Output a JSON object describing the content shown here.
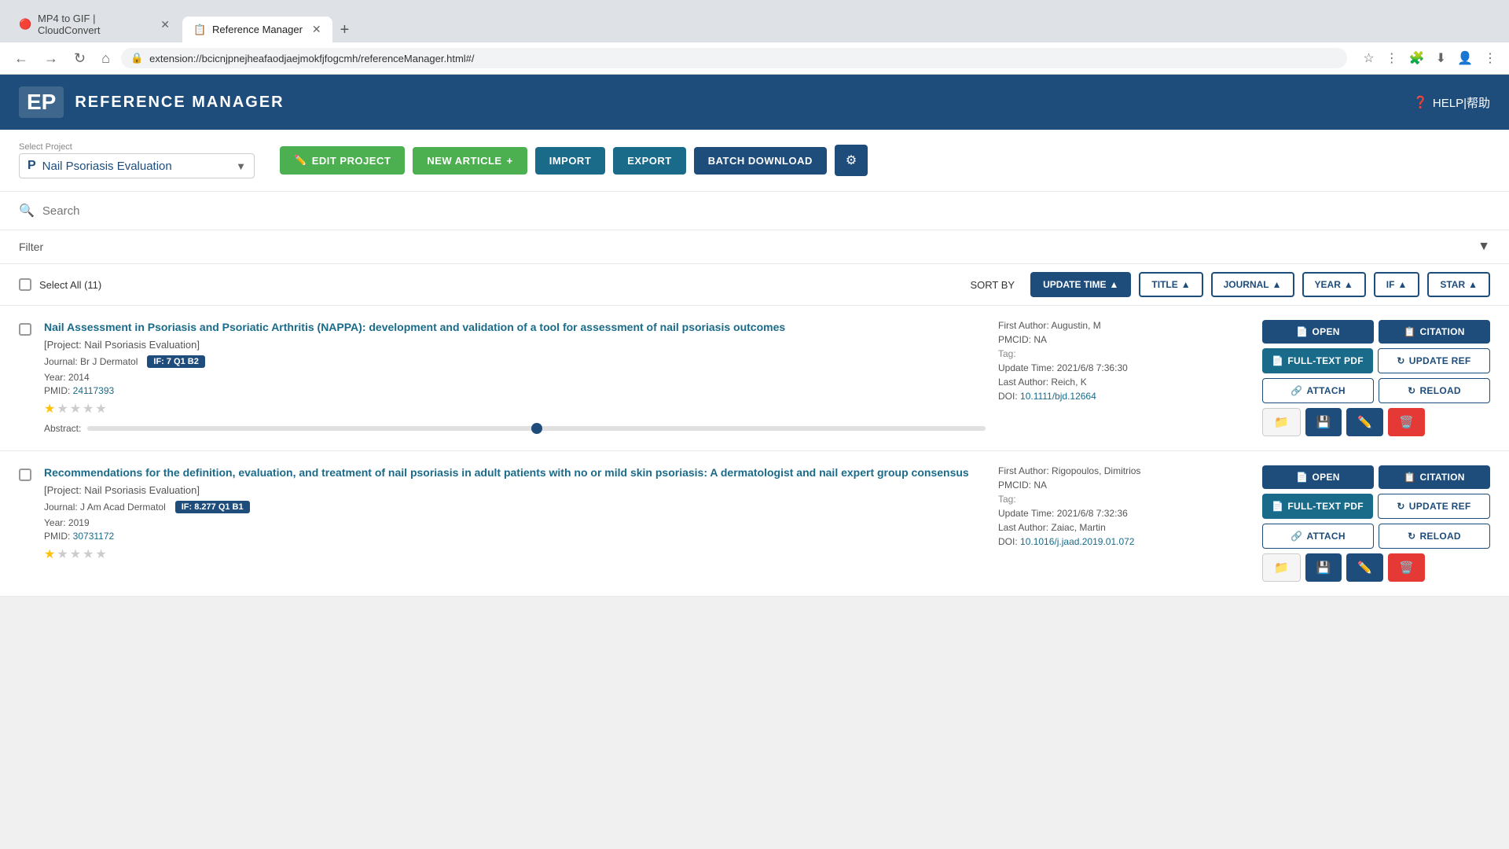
{
  "browser": {
    "tabs": [
      {
        "id": "tab1",
        "label": "MP4 to GIF | CloudConvert",
        "favicon": "🔴",
        "active": false
      },
      {
        "id": "tab2",
        "label": "Reference Manager",
        "favicon": "📋",
        "active": true
      }
    ],
    "url": "extension://bcicnjpnejheafaodjaejmokfjfogcmh/referenceManager.html#/",
    "new_tab": "+"
  },
  "app": {
    "logo_text": "EP",
    "title": "REFERENCE MANAGER",
    "help_label": "HELP|帮助"
  },
  "project": {
    "select_label": "Select Project",
    "icon": "P",
    "name": "Nail Psoriasis Evaluation",
    "buttons": {
      "edit": "EDIT PROJECT",
      "new_article": "NEW ARTICLE",
      "import": "IMPORT",
      "export": "EXPORT",
      "batch_download": "BATCH DOWNLOAD"
    }
  },
  "search": {
    "placeholder": "Search"
  },
  "filter": {
    "label": "Filter"
  },
  "sort": {
    "label": "SORT BY",
    "select_all_label": "Select All (11)",
    "buttons": [
      {
        "id": "update_time",
        "label": "UPDATE TIME",
        "active": true,
        "direction": "▲"
      },
      {
        "id": "title",
        "label": "TITLE",
        "active": false,
        "direction": "▲"
      },
      {
        "id": "journal",
        "label": "JOURNAL",
        "active": false,
        "direction": "▲"
      },
      {
        "id": "year",
        "label": "YEAR",
        "active": false,
        "direction": "▲"
      },
      {
        "id": "if",
        "label": "IF",
        "active": false,
        "direction": "▲"
      },
      {
        "id": "star",
        "label": "STAR",
        "active": false,
        "direction": "▲"
      }
    ]
  },
  "articles": [
    {
      "id": "article1",
      "title": "Nail Assessment in Psoriasis and Psoriatic Arthritis (NAPPA): development and validation of a tool for assessment of nail psoriasis outcomes",
      "project": "[Project: Nail Psoriasis Evaluation]",
      "journal": "Br J Dermatol",
      "if_badge": "IF: 7 Q1 B2",
      "year": "2014",
      "pmid": "24117393",
      "pmcid": "NA",
      "first_author": "Augustin, M",
      "last_author": "Reich, K",
      "update_time": "2021/6/8 7:36:30",
      "doi": "10.1111/bjd.12664",
      "doi_url": "#",
      "tag": "",
      "stars": 1,
      "total_stars": 5,
      "actions": {
        "open": "OPEN",
        "citation": "CITATION",
        "full_text_pdf": "FULL-TEXT PDF",
        "update_ref": "UPDATE REF",
        "attach": "ATTACH",
        "reload": "RELOAD"
      }
    },
    {
      "id": "article2",
      "title": "Recommendations for the definition, evaluation, and treatment of nail psoriasis in adult patients with no or mild skin psoriasis: A dermatologist and nail expert group consensus",
      "project": "[Project: Nail Psoriasis Evaluation]",
      "journal": "J Am Acad Dermatol",
      "if_badge": "IF: 8.277 Q1 B1",
      "year": "2019",
      "pmid": "30731172",
      "pmcid": "NA",
      "first_author": "Rigopoulos, Dimitrios",
      "last_author": "Zaiac, Martin",
      "update_time": "2021/6/8 7:32:36",
      "doi": "10.1016/j.jaad.2019.01.072",
      "doi_url": "#",
      "tag": "",
      "stars": 1,
      "total_stars": 5,
      "actions": {
        "open": "OPEN",
        "citation": "CITATION",
        "full_text_pdf": "FULL-TEXT PDF",
        "update_ref": "UPDATE REF",
        "attach": "ATTACH",
        "reload": "RELOAD"
      }
    }
  ]
}
